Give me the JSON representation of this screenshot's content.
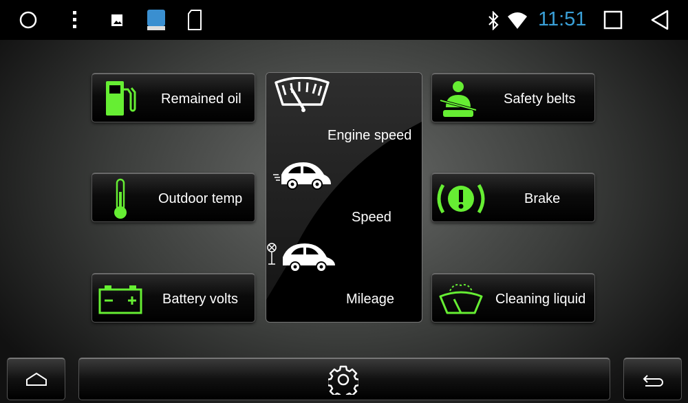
{
  "status_bar": {
    "time": "11:51",
    "clock_color": "#3aa0d8",
    "icons": [
      "circle-home-icon",
      "overflow-menu-icon",
      "gallery-icon",
      "app-notification-icon",
      "sd-card-icon",
      "bluetooth-icon",
      "wifi-icon",
      "recents-icon",
      "back-triangle-icon"
    ]
  },
  "accent_color": "#66ee33",
  "tiles": {
    "remained_oil": {
      "label": "Remained oil",
      "icon": "fuel-pump-icon"
    },
    "outdoor_temp": {
      "label": "Outdoor temp",
      "icon": "thermometer-icon"
    },
    "battery_volts": {
      "label": "Battery volts",
      "icon": "battery-icon"
    },
    "safety_belts": {
      "label": "Safety belts",
      "icon": "seatbelt-icon"
    },
    "brake": {
      "label": "Brake",
      "icon": "brake-warning-icon"
    },
    "cleaning_liquid": {
      "label": "Cleaning liquid",
      "icon": "washer-fluid-icon"
    }
  },
  "center_panel": {
    "engine_speed": {
      "label": "Engine speed",
      "icon": "tachometer-icon"
    },
    "speed": {
      "label": "Speed",
      "icon": "fast-car-icon"
    },
    "mileage": {
      "label": "Mileage",
      "icon": "car-mileage-icon"
    }
  },
  "bottom_bar": {
    "icons": [
      "home-icon",
      "settings-gear-icon",
      "return-icon"
    ]
  }
}
